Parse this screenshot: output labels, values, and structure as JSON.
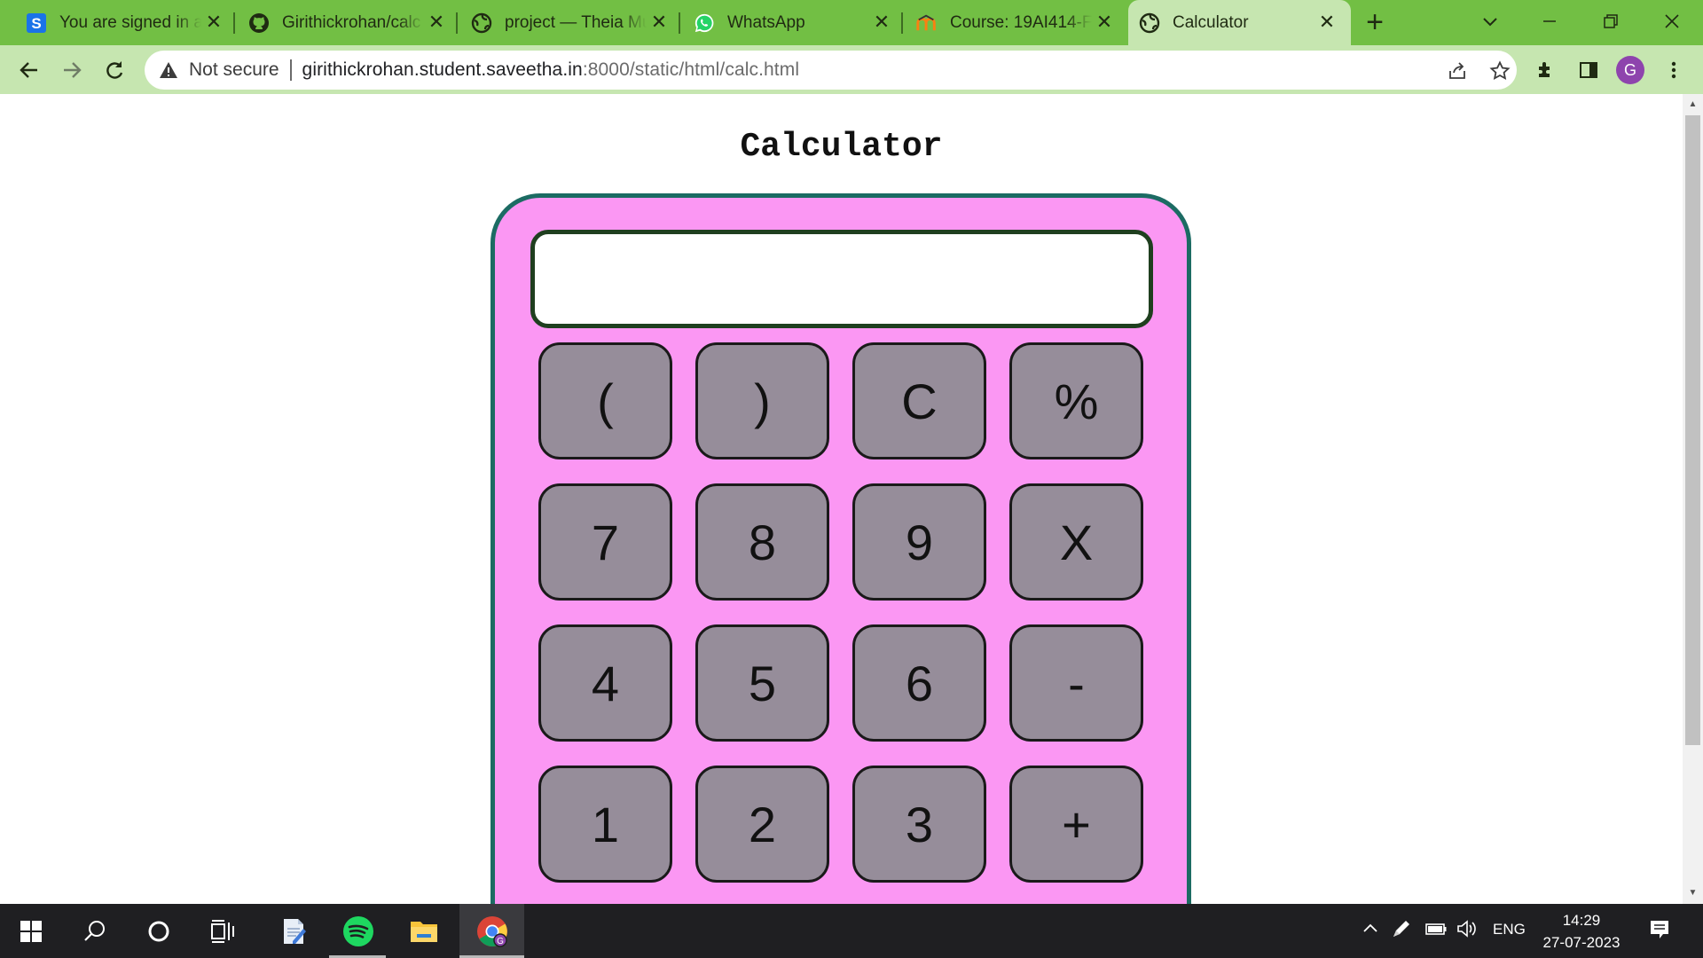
{
  "tabs": [
    {
      "title": "You are signed in a",
      "icon": "s-logo-icon",
      "active": false
    },
    {
      "title": "Girithickrohan/calc",
      "icon": "github-icon",
      "active": false
    },
    {
      "title": "project — Theia Mu",
      "icon": "globe-icon",
      "active": false
    },
    {
      "title": "WhatsApp",
      "icon": "whatsapp-icon",
      "active": false
    },
    {
      "title": "Course: 19AI414-Fu",
      "icon": "moodle-icon",
      "active": false
    },
    {
      "title": "Calculator",
      "icon": "globe-icon",
      "active": true
    }
  ],
  "new_tab_label": "+",
  "toolbar": {
    "security_label": "Not secure",
    "url_host": "girithickrohan.student.saveetha.in",
    "url_rest": ":8000/static/html/calc.html",
    "profile_initial": "G"
  },
  "page": {
    "heading": "Calculator",
    "display_value": "",
    "keys": [
      "(",
      ")",
      "C",
      "%",
      "7",
      "8",
      "9",
      "X",
      "4",
      "5",
      "6",
      "-",
      "1",
      "2",
      "3",
      "+"
    ]
  },
  "colors": {
    "tab_strip": "#72bf44",
    "toolbar": "#c6e6b0",
    "calculator_body": "#fb97f3",
    "calculator_border": "#1c6b63",
    "key_face": "#968d9a"
  },
  "taskbar": {
    "language": "ENG",
    "time": "14:29",
    "date": "27-07-2023"
  }
}
